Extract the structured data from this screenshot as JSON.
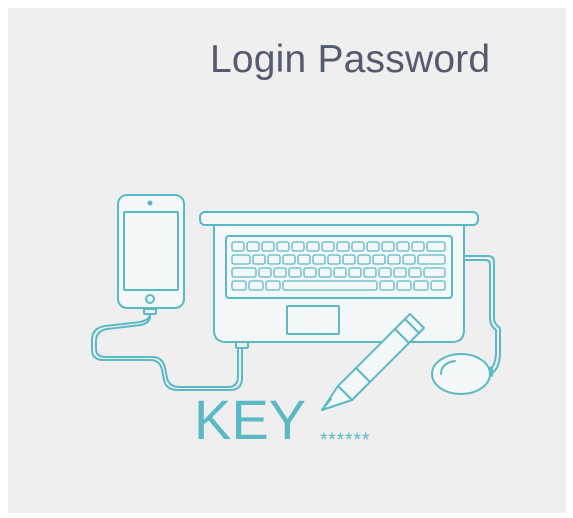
{
  "title": "Login Password",
  "illustration": {
    "key_text": "KEY",
    "password_mask": "******",
    "icons": [
      "smartphone-icon",
      "laptop-icon",
      "pencil-icon",
      "mouse-icon"
    ],
    "colors": {
      "stroke": "#5bb9c6",
      "fill": "#f4f8f9",
      "background": "#efefef",
      "title": "#555a6e"
    }
  }
}
